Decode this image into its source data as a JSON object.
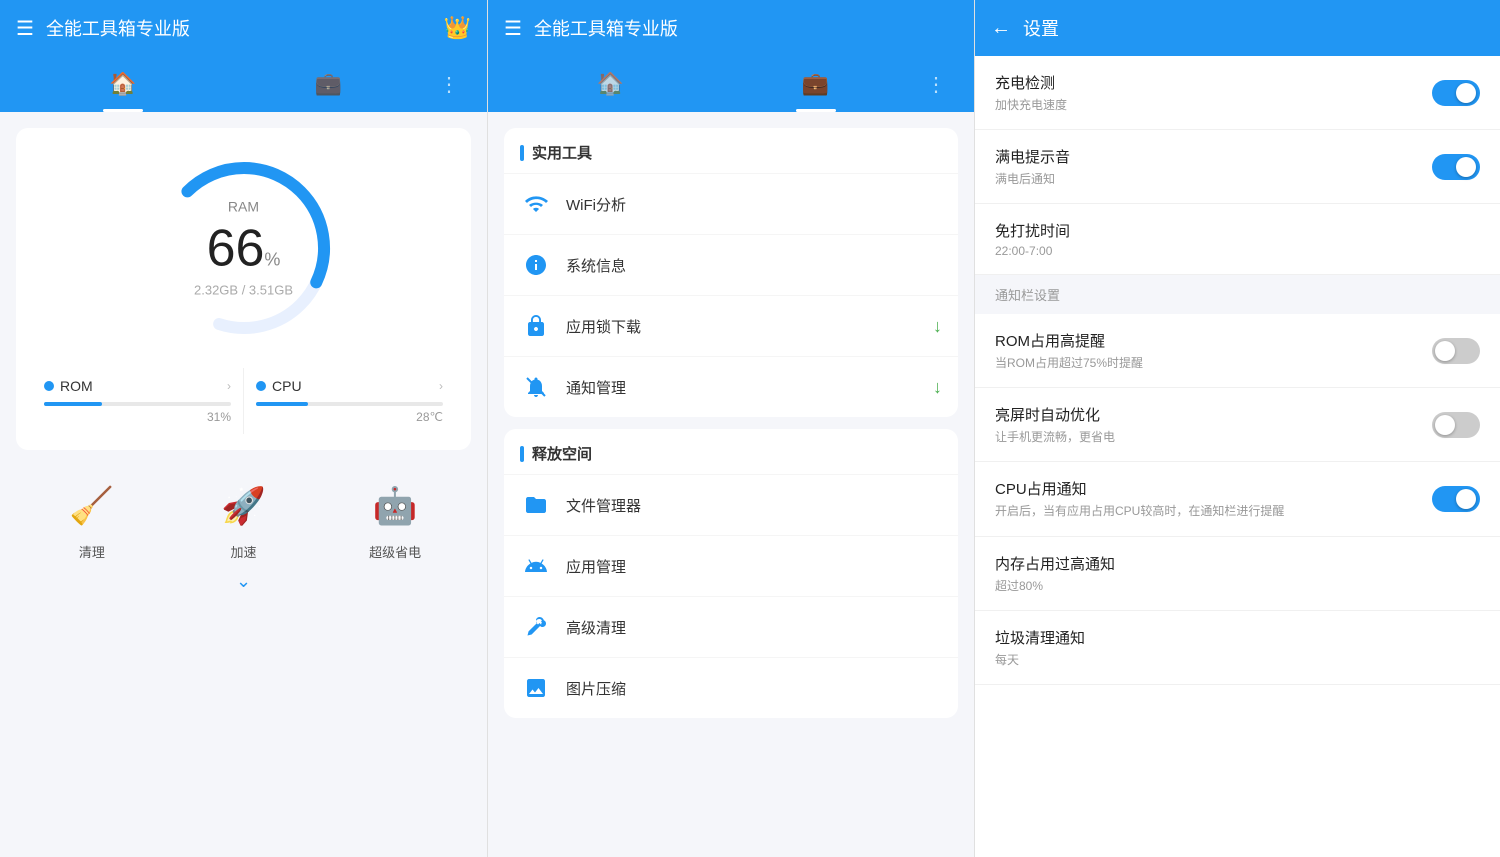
{
  "panel1": {
    "header": {
      "title": "全能工具箱专业版",
      "crown": "👑"
    },
    "tabs": [
      {
        "label": "home",
        "icon": "🏠",
        "active": true
      },
      {
        "label": "tools",
        "icon": "💼",
        "active": false
      },
      {
        "label": "more",
        "icon": "⋮",
        "active": false
      }
    ],
    "ram": {
      "label": "RAM",
      "percent": "66",
      "unit": "%",
      "sub": "2.32GB / 3.51GB"
    },
    "stats": [
      {
        "name": "ROM",
        "percent": 31,
        "value": "31%"
      },
      {
        "name": "CPU",
        "percent": 28,
        "value": "28℃"
      }
    ],
    "actions": [
      {
        "label": "清理",
        "icon": "🧹"
      },
      {
        "label": "加速",
        "icon": "🚀"
      },
      {
        "label": "超级省电",
        "icon": "🤖"
      }
    ]
  },
  "panel2": {
    "header": {
      "title": "全能工具箱专业版"
    },
    "sections": [
      {
        "title": "实用工具",
        "items": [
          {
            "icon": "wifi",
            "label": "WiFi分析",
            "badge": false
          },
          {
            "icon": "info",
            "label": "系统信息",
            "badge": false
          },
          {
            "icon": "lock",
            "label": "应用锁下载",
            "badge": true
          },
          {
            "icon": "bell_off",
            "label": "通知管理",
            "badge": true
          }
        ]
      },
      {
        "title": "释放空间",
        "items": [
          {
            "icon": "folder",
            "label": "文件管理器",
            "badge": false
          },
          {
            "icon": "android",
            "label": "应用管理",
            "badge": false
          },
          {
            "icon": "clean",
            "label": "高级清理",
            "badge": false
          },
          {
            "icon": "image",
            "label": "图片压缩",
            "badge": false
          }
        ]
      }
    ]
  },
  "panel3": {
    "header": {
      "title": "设置",
      "back_label": "←"
    },
    "settings": [
      {
        "name": "充电检测",
        "desc": "加快充电速度",
        "toggle": "on",
        "section_header": null
      },
      {
        "name": "满电提示音",
        "desc": "满电后通知",
        "toggle": "on",
        "section_header": null
      },
      {
        "name": "免打扰时间",
        "desc": "22:00-7:00",
        "toggle": null,
        "section_header": null
      },
      {
        "name": "通知栏设置",
        "desc": null,
        "toggle": null,
        "section_header": "通知栏设置",
        "is_header": true
      },
      {
        "name": "ROM占用高提醒",
        "desc": "当ROM占用超过75%时提醒",
        "toggle": "off",
        "section_header": null
      },
      {
        "name": "亮屏时自动优化",
        "desc": "让手机更流畅，更省电",
        "toggle": "off",
        "section_header": null
      },
      {
        "name": "CPU占用通知",
        "desc": "开启后，当有应用占用CPU较高时，在通知栏进行提醒",
        "toggle": "on",
        "section_header": null
      },
      {
        "name": "内存占用过高通知",
        "desc": "超过80%",
        "toggle": null,
        "section_header": null
      },
      {
        "name": "垃圾清理通知",
        "desc": "每天",
        "toggle": null,
        "section_header": null
      }
    ]
  }
}
